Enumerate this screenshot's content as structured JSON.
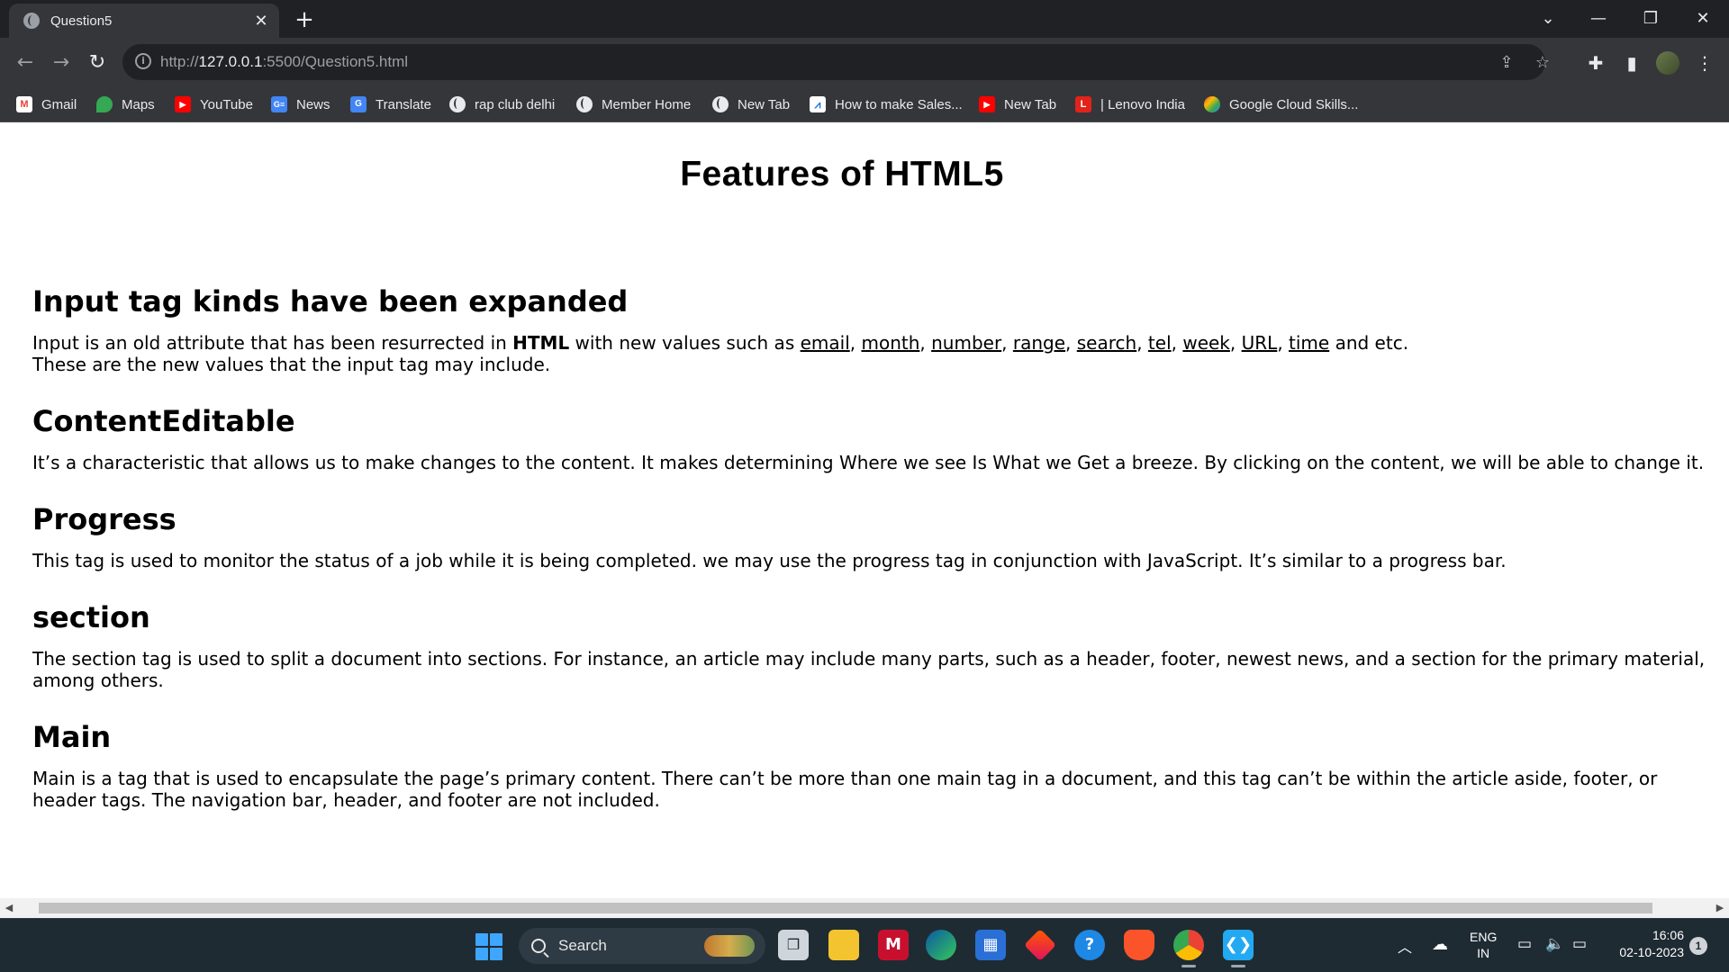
{
  "browser": {
    "tab_title": "Question5",
    "url_prefix": "http://",
    "url_host": "127.0.0.1",
    "url_rest": ":5500/Question5.html"
  },
  "bookmarks": [
    {
      "label": "Gmail",
      "icon": "gmail-icon"
    },
    {
      "label": "Maps",
      "icon": "maps-icon"
    },
    {
      "label": "YouTube",
      "icon": "youtube-icon"
    },
    {
      "label": "News",
      "icon": "news-icon"
    },
    {
      "label": "Translate",
      "icon": "translate-icon"
    },
    {
      "label": "rap club delhi",
      "icon": "globe-icon"
    },
    {
      "label": "Member Home",
      "icon": "globe-icon"
    },
    {
      "label": "New Tab",
      "icon": "globe-icon"
    },
    {
      "label": "How to make Sales...",
      "icon": "chart-icon"
    },
    {
      "label": "New Tab",
      "icon": "youtube-icon"
    },
    {
      "label": "| Lenovo India",
      "icon": "lenovo-icon"
    },
    {
      "label": "Google Cloud Skills...",
      "icon": "google-cloud-icon"
    }
  ],
  "page": {
    "title": "Features of HTML5",
    "sections": [
      {
        "heading": "Input tag kinds have been expanded",
        "text_before": "Input is an old attribute that has been resurrected in ",
        "bold": "HTML",
        "text_mid": " with new values such as ",
        "links": [
          "email",
          "month",
          "number",
          "range",
          "search",
          "tel",
          "week",
          "URL",
          "time"
        ],
        "text_after": " and etc.",
        "line2": "These are the new values that the input tag may include."
      },
      {
        "heading": "ContentEditable",
        "text": "It’s a characteristic that allows us to make changes to the content. It makes determining Where we see Is What we Get a breeze. By clicking on the content, we will be able to change it."
      },
      {
        "heading": "Progress",
        "text": "This tag is used to monitor the status of a job while it is being completed. we may use the progress tag in conjunction with JavaScript. It’s similar to a progress bar."
      },
      {
        "heading": "section",
        "text": "The section tag is used to split a document into sections. For instance, an article may include many parts, such as a header, footer, newest news, and a section for the primary material, among others."
      },
      {
        "heading": "Main",
        "text": "Main is a tag that is used to encapsulate the page’s primary content. There can’t be more than one main tag in a document, and this tag can’t be within the article aside, footer, or header tags. The navigation bar, header, and footer are not included."
      }
    ]
  },
  "taskbar": {
    "search_label": "Search",
    "lang_line1": "ENG",
    "lang_line2": "IN",
    "time": "16:06",
    "date": "02-10-2023",
    "notification_count": "1"
  }
}
